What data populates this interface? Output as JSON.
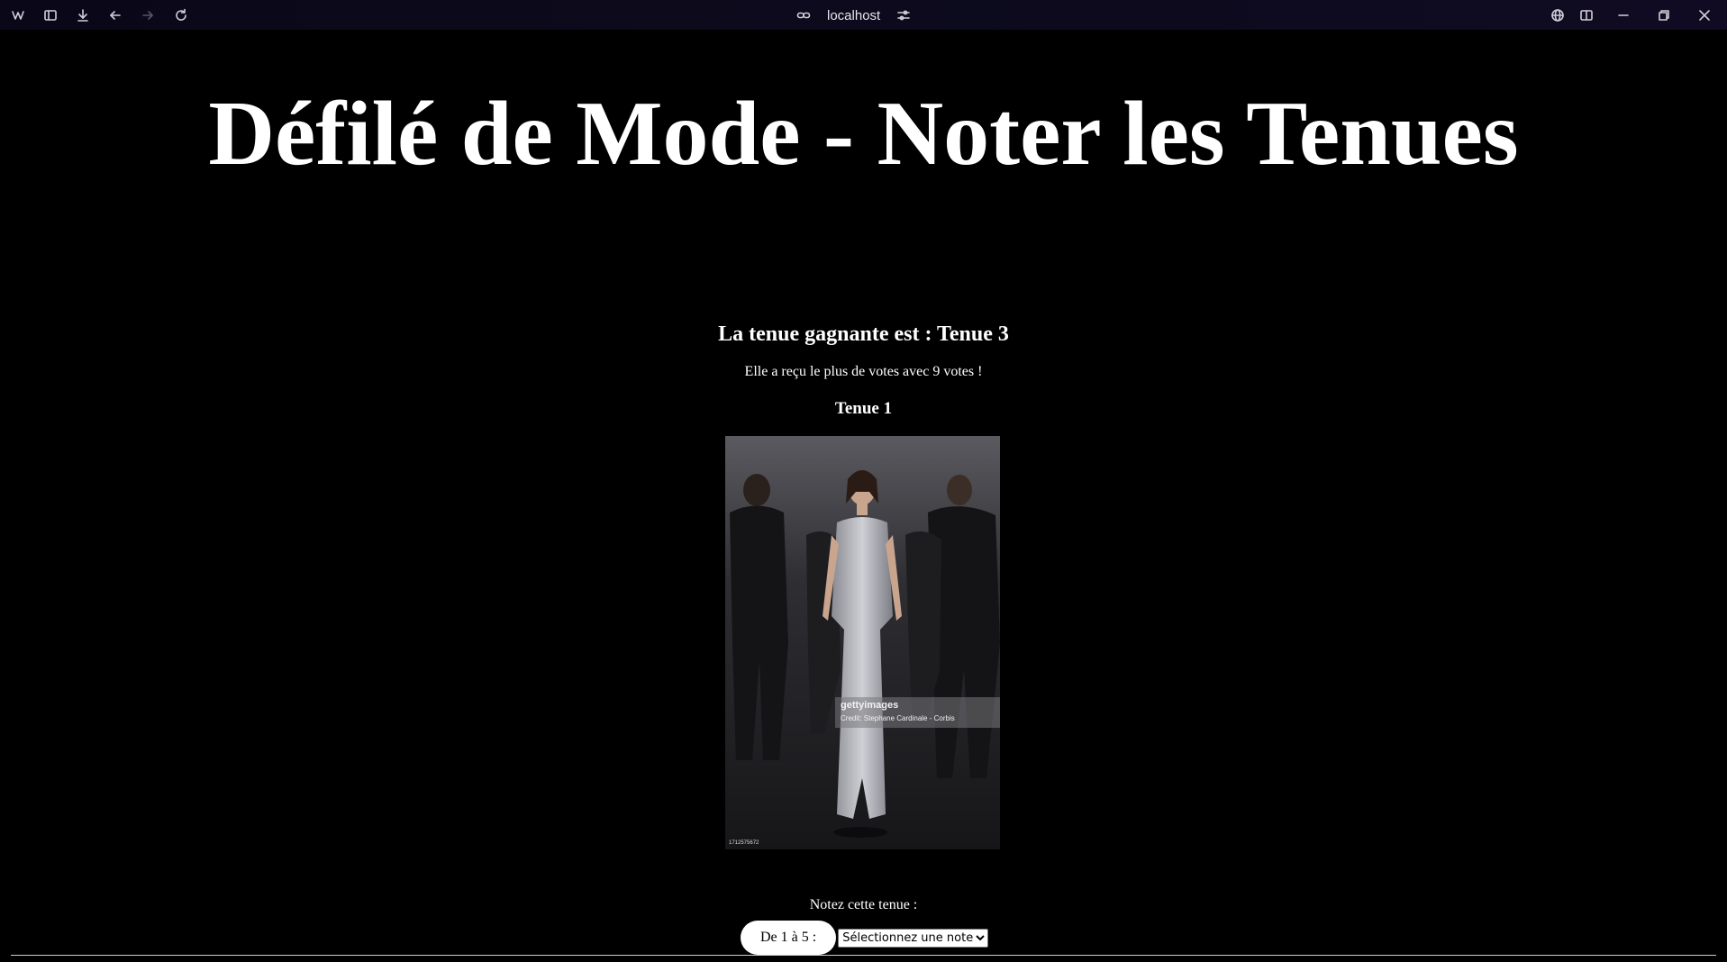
{
  "browser": {
    "url": "localhost"
  },
  "page": {
    "title": "Défilé de Mode - Noter les Tenues",
    "winner_heading": "La tenue gagnante est : Tenue 3",
    "winner_text": "Elle a reçu le plus de votes avec 9 votes !",
    "outfit_title": "Tenue 1",
    "photo": {
      "watermark_brand": "gettyimages",
      "watermark_credit": "Credit: Stephane Cardinale - Corbis",
      "photo_id": "1712575672"
    },
    "rate_label": "Notez cette tenue :",
    "range_label": "De 1 à 5 :",
    "select": {
      "selected": "Sélectionnez une note",
      "options": [
        "Sélectionnez une note"
      ]
    }
  },
  "colors": {
    "background": "#000000",
    "text": "#ffffff",
    "browser_bar": "#0c0a1c"
  }
}
